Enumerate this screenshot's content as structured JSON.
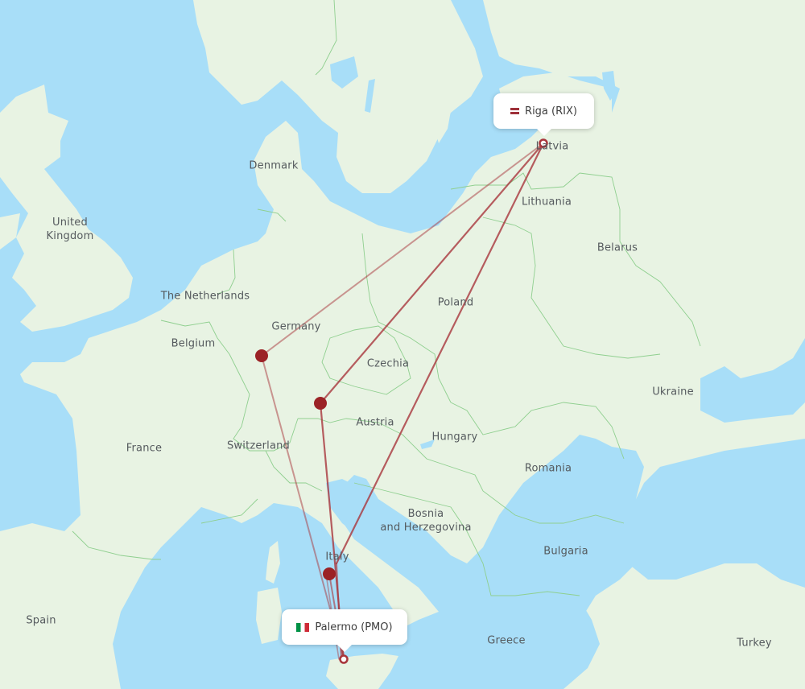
{
  "map": {
    "origin": {
      "city": "Riga",
      "code": "RIX",
      "label": "Riga (RIX)",
      "flag": "latvia-flag"
    },
    "destination": {
      "city": "Palermo",
      "code": "PMO",
      "label": "Palermo (PMO)",
      "flag": "italy-flag"
    },
    "colors": {
      "route": "#a8363c",
      "stop": "#9b2226",
      "water": "#a8def8",
      "land": "#e8f3e3",
      "border": "#8fcf8f"
    },
    "stopovers_count": 3,
    "countries": [
      "United Kingdom",
      "Denmark",
      "The Netherlands",
      "Belgium",
      "Germany",
      "Czechia",
      "Poland",
      "Lithuania",
      "Latvia",
      "Belarus",
      "Ukraine",
      "France",
      "Switzerland",
      "Austria",
      "Hungary",
      "Romania",
      "Bosnia and Herzegovina",
      "Italy",
      "Bulgaria",
      "Spain",
      "Greece",
      "Turkey"
    ]
  },
  "labels": {
    "uk_1": "United",
    "uk_2": "Kingdom",
    "denmark": "Denmark",
    "netherlands": "The Netherlands",
    "belgium": "Belgium",
    "germany": "Germany",
    "czechia": "Czechia",
    "poland": "Poland",
    "lithuania": "Lithuania",
    "latvia": "Latvia",
    "belarus": "Belarus",
    "ukraine": "Ukraine",
    "france": "France",
    "switzerland": "Switzerland",
    "austria": "Austria",
    "hungary": "Hungary",
    "romania": "Romania",
    "bosnia_1": "Bosnia",
    "bosnia_2": "and Herzegovina",
    "italy": "Italy",
    "bulgaria": "Bulgaria",
    "spain": "Spain",
    "greece": "Greece",
    "turkey": "Turkey"
  }
}
